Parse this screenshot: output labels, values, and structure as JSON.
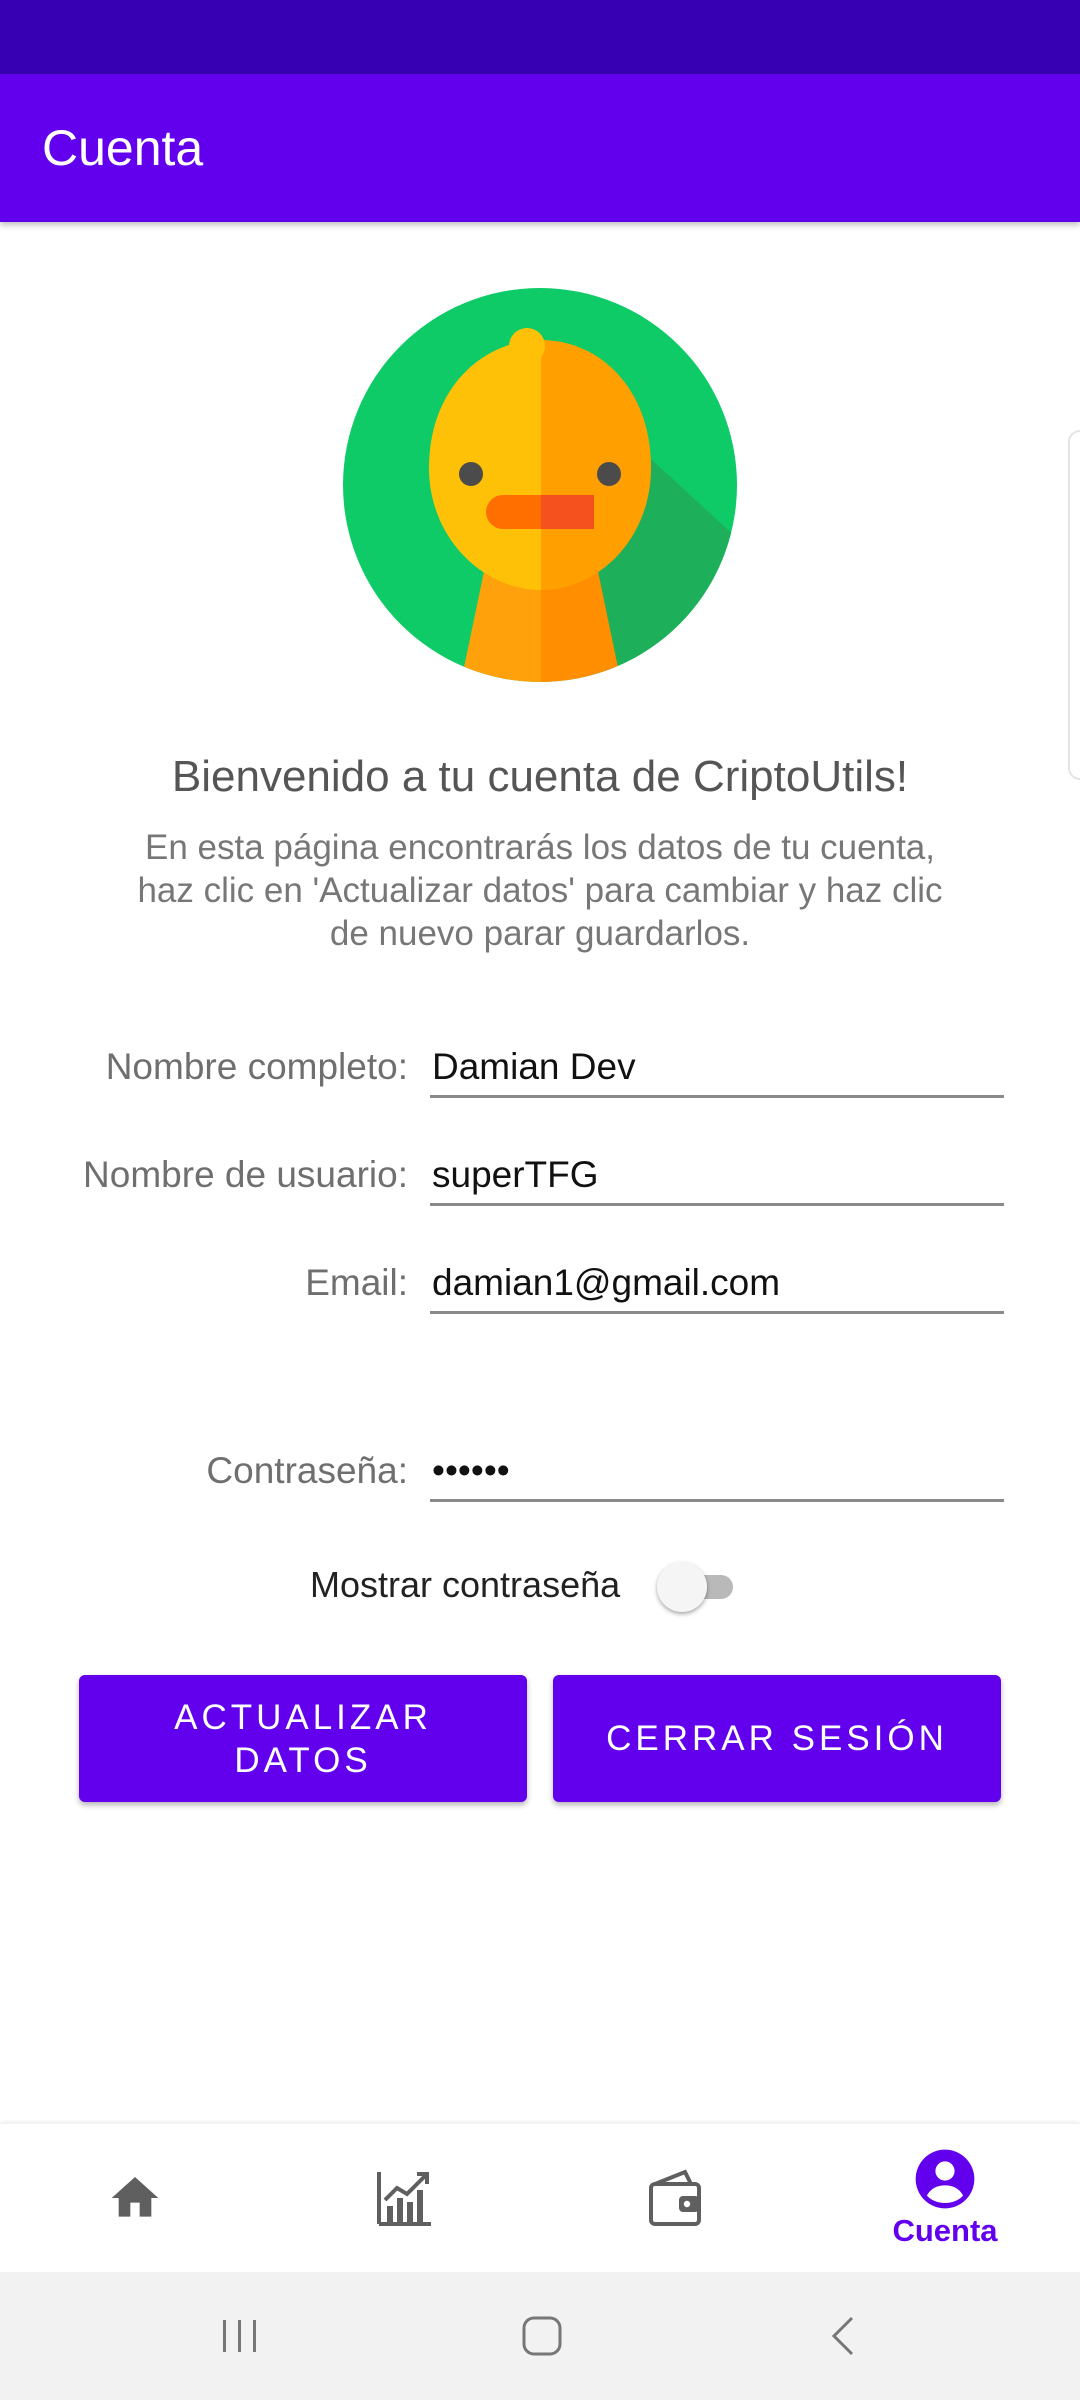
{
  "app_bar": {
    "title": "Cuenta"
  },
  "welcome": {
    "title": "Bienvenido a tu cuenta de CriptoUtils!",
    "description": "En esta página encontrarás los datos de tu cuenta, haz clic en 'Actualizar datos' para cambiar y haz clic de nuevo parar guardarlos."
  },
  "form": {
    "full_name": {
      "label": "Nombre completo:",
      "value": "Damian Dev"
    },
    "username": {
      "label": "Nombre de usuario:",
      "value": "superTFG"
    },
    "email": {
      "label": "Email:",
      "value": "damian1@gmail.com"
    },
    "password": {
      "label": "Contraseña:",
      "value": "••••••"
    },
    "show_password": {
      "label": "Mostrar contraseña",
      "checked": false
    }
  },
  "buttons": {
    "update": "ACTUALIZAR DATOS",
    "logout": "CERRAR SESIÓN"
  },
  "bottom_nav": {
    "items": [
      {
        "icon": "home-icon",
        "label": ""
      },
      {
        "icon": "chart-icon",
        "label": ""
      },
      {
        "icon": "wallet-icon",
        "label": ""
      },
      {
        "icon": "account-icon",
        "label": "Cuenta",
        "active": true
      }
    ]
  },
  "colors": {
    "primary": "#6200ee",
    "primary_dark": "#3700b3",
    "nav_inactive": "#5f5f5f"
  }
}
